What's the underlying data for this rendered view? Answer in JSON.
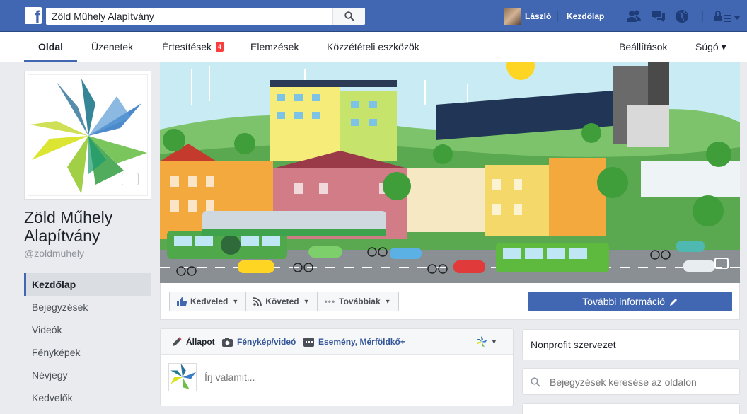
{
  "topbar": {
    "search_value": "Zöld Műhely Alapítvány",
    "user_name": "László",
    "home_label": "Kezdőlap",
    "icons": [
      "friend-requests-icon",
      "messages-icon",
      "notifications-globe-icon",
      "privacy-lock-icon",
      "account-menu-icon"
    ]
  },
  "page_tabs": {
    "items": [
      {
        "label": "Oldal"
      },
      {
        "label": "Üzenetek"
      },
      {
        "label": "Értesítések",
        "badge": "4"
      },
      {
        "label": "Elemzések"
      },
      {
        "label": "Közzétételi eszközök"
      }
    ],
    "settings_label": "Beállítások",
    "help_label": "Súgó ▾"
  },
  "page": {
    "name": "Zöld Műhely Alapítvány",
    "handle": "@zoldmuhely"
  },
  "left_nav": {
    "items": [
      {
        "label": "Kezdőlap"
      },
      {
        "label": "Bejegyzések"
      },
      {
        "label": "Videók"
      },
      {
        "label": "Fényképek"
      },
      {
        "label": "Névjegy"
      },
      {
        "label": "Kedvelők"
      }
    ]
  },
  "actions": {
    "like_label": "Kedveled",
    "follow_label": "Követed",
    "more_label": "Továbbiak",
    "more_info_label": "További információ"
  },
  "composer": {
    "tabs": [
      {
        "label": "Állapot"
      },
      {
        "label": "Fénykép/videó"
      },
      {
        "label": "Esemény, Mérföldkő+"
      }
    ],
    "placeholder": "Írj valamit..."
  },
  "right": {
    "category": "Nonprofit szervezet",
    "search_placeholder": "Bejegyzések keresése az oldalon"
  },
  "colors": {
    "facebook_blue": "#4267b2",
    "badge_red": "#fa3e3e",
    "background": "#e9ebee"
  }
}
